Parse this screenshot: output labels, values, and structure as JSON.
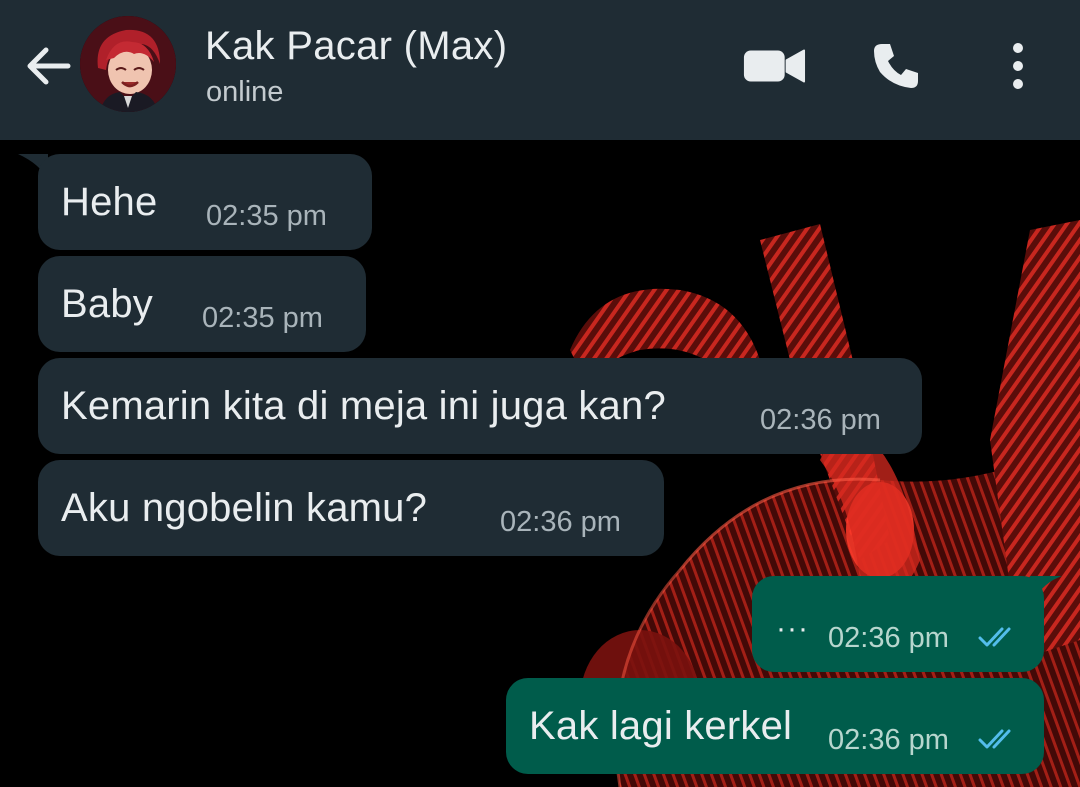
{
  "header": {
    "contact_name": "Kak Pacar (Max)",
    "status": "online",
    "icons": {
      "back": "arrow-back-icon",
      "video": "video-call-icon",
      "call": "phone-call-icon",
      "menu": "more-vert-icon"
    }
  },
  "messages": [
    {
      "direction": "incoming",
      "text": "Hehe",
      "time": "02:35 pm"
    },
    {
      "direction": "incoming",
      "text": "Baby",
      "time": "02:35 pm"
    },
    {
      "direction": "incoming",
      "text": "Kemarin kita di meja ini juga kan?",
      "time": "02:36 pm"
    },
    {
      "direction": "incoming",
      "text": "Aku ngobelin kamu?",
      "time": "02:36 pm"
    },
    {
      "direction": "outgoing",
      "text": "···",
      "time": "02:36 pm",
      "status": "read"
    },
    {
      "direction": "outgoing",
      "text": "Kak lagi kerkel",
      "time": "02:36 pm",
      "status": "read"
    }
  ],
  "colors": {
    "header_bg": "#1f2c34",
    "incoming_bubble": "#1f2c34",
    "outgoing_bubble": "#005c4b",
    "read_ticks": "#53bdeb",
    "wallpaper_accent": "#c8271f"
  }
}
